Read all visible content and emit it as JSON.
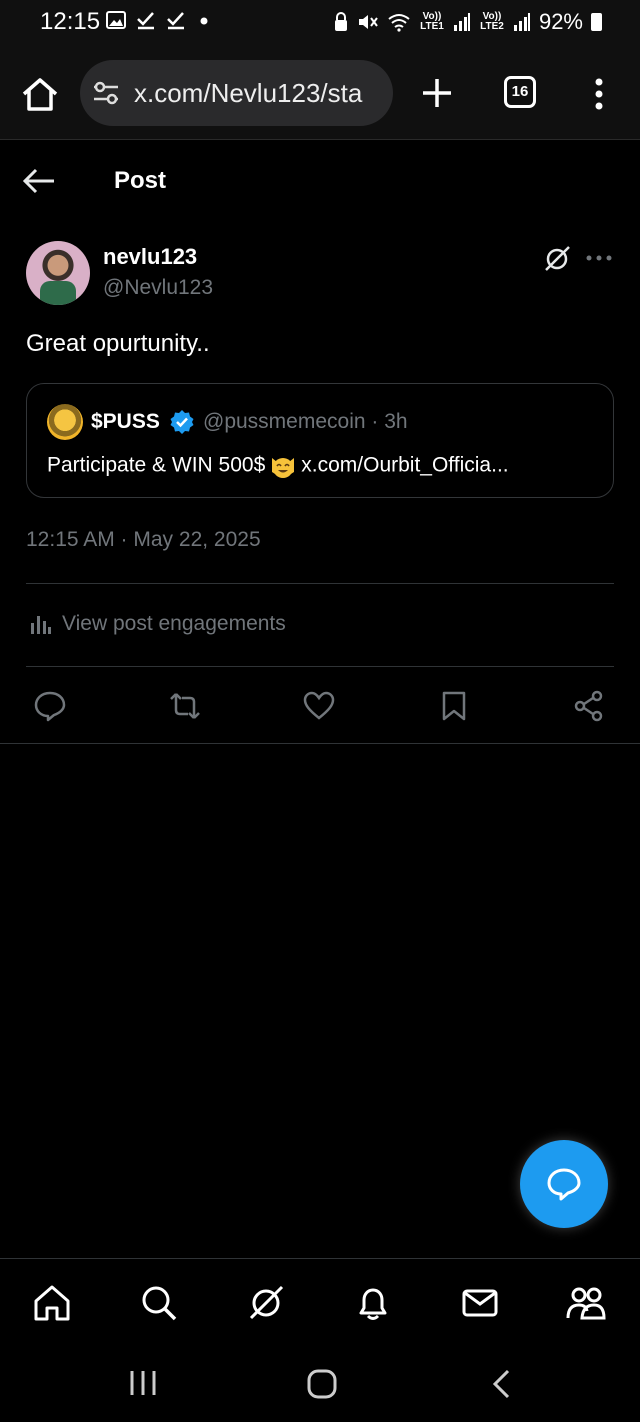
{
  "status_bar": {
    "time": "12:15",
    "net1_label": "Vo)) LTE1",
    "net2_label": "Vo)) LTE2",
    "battery": "92%"
  },
  "browser": {
    "url": "x.com/Nevlu123/sta",
    "tab_count": "16"
  },
  "header": {
    "title": "Post"
  },
  "post": {
    "author_name": "nevlu123",
    "author_handle": "@Nevlu123",
    "text": "Great opurtunity..",
    "timestamp": "12:15 AM · May 22, 2025",
    "engagements_label": "View post engagements"
  },
  "quoted_post": {
    "name": "$PUSS",
    "handle_time": "@pussmemecoin · 3h",
    "text_before": "Participate & WIN 500$",
    "text_after": "x.com/Ourbit_Officia..."
  },
  "colors": {
    "accent": "#1d9bf0",
    "muted_text": "#71767b",
    "background": "#000000"
  },
  "icons": {
    "actions": [
      "reply-icon",
      "repost-icon",
      "like-icon",
      "bookmark-icon",
      "share-icon"
    ],
    "bottom_nav": [
      "home-icon",
      "search-icon",
      "grok-icon",
      "notifications-icon",
      "messages-icon",
      "communities-icon"
    ]
  }
}
